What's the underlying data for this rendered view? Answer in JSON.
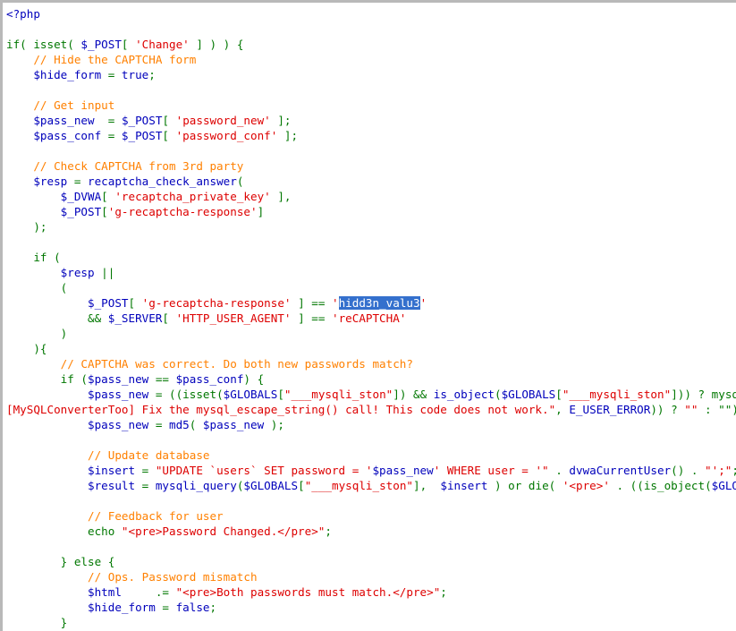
{
  "colors": {
    "keyword": "#007700",
    "variable": "#0000bb",
    "string": "#dd0000",
    "comment": "#ff8000",
    "selection_bg": "#3470cd",
    "selection_fg": "#ffffff"
  },
  "lines": [
    [
      [
        "var",
        "<?php"
      ]
    ],
    [],
    [
      [
        "kw",
        "if( isset( "
      ],
      [
        "var",
        "$_POST"
      ],
      [
        "kw",
        "[ "
      ],
      [
        "str",
        "'Change'"
      ],
      [
        "kw",
        " ] ) ) {"
      ]
    ],
    [
      [
        "kw",
        "    "
      ],
      [
        "cmt",
        "// Hide the CAPTCHA form"
      ]
    ],
    [
      [
        "kw",
        "    "
      ],
      [
        "var",
        "$hide_form"
      ],
      [
        "kw",
        " = "
      ],
      [
        "var",
        "true"
      ],
      [
        "kw",
        ";"
      ]
    ],
    [],
    [
      [
        "kw",
        "    "
      ],
      [
        "cmt",
        "// Get input"
      ]
    ],
    [
      [
        "kw",
        "    "
      ],
      [
        "var",
        "$pass_new"
      ],
      [
        "kw",
        "  = "
      ],
      [
        "var",
        "$_POST"
      ],
      [
        "kw",
        "[ "
      ],
      [
        "str",
        "'password_new'"
      ],
      [
        "kw",
        " ];"
      ]
    ],
    [
      [
        "kw",
        "    "
      ],
      [
        "var",
        "$pass_conf"
      ],
      [
        "kw",
        " = "
      ],
      [
        "var",
        "$_POST"
      ],
      [
        "kw",
        "[ "
      ],
      [
        "str",
        "'password_conf'"
      ],
      [
        "kw",
        " ];"
      ]
    ],
    [],
    [
      [
        "kw",
        "    "
      ],
      [
        "cmt",
        "// Check CAPTCHA from 3rd party"
      ]
    ],
    [
      [
        "kw",
        "    "
      ],
      [
        "var",
        "$resp"
      ],
      [
        "kw",
        " = "
      ],
      [
        "var",
        "recaptcha_check_answer"
      ],
      [
        "kw",
        "("
      ]
    ],
    [
      [
        "kw",
        "        "
      ],
      [
        "var",
        "$_DVWA"
      ],
      [
        "kw",
        "[ "
      ],
      [
        "str",
        "'recaptcha_private_key'"
      ],
      [
        "kw",
        " ],"
      ]
    ],
    [
      [
        "kw",
        "        "
      ],
      [
        "var",
        "$_POST"
      ],
      [
        "kw",
        "["
      ],
      [
        "str",
        "'g-recaptcha-response'"
      ],
      [
        "kw",
        "]"
      ]
    ],
    [
      [
        "kw",
        "    );"
      ]
    ],
    [],
    [
      [
        "kw",
        "    if ("
      ]
    ],
    [
      [
        "kw",
        "        "
      ],
      [
        "var",
        "$resp"
      ],
      [
        "kw",
        " ||"
      ]
    ],
    [
      [
        "kw",
        "        ("
      ]
    ],
    [
      [
        "kw",
        "            "
      ],
      [
        "var",
        "$_POST"
      ],
      [
        "kw",
        "[ "
      ],
      [
        "str",
        "'g-recaptcha-response'"
      ],
      [
        "kw",
        " ] == "
      ],
      [
        "str",
        "'"
      ],
      [
        "hl",
        "hidd3n_valu3"
      ],
      [
        "str",
        "'"
      ]
    ],
    [
      [
        "kw",
        "            && "
      ],
      [
        "var",
        "$_SERVER"
      ],
      [
        "kw",
        "[ "
      ],
      [
        "str",
        "'HTTP_USER_AGENT'"
      ],
      [
        "kw",
        " ] == "
      ],
      [
        "str",
        "'reCAPTCHA'"
      ]
    ],
    [
      [
        "kw",
        "        )"
      ]
    ],
    [
      [
        "kw",
        "    ){"
      ]
    ],
    [
      [
        "kw",
        "        "
      ],
      [
        "cmt",
        "// CAPTCHA was correct. Do both new passwords match?"
      ]
    ],
    [
      [
        "kw",
        "        if ("
      ],
      [
        "var",
        "$pass_new"
      ],
      [
        "kw",
        " == "
      ],
      [
        "var",
        "$pass_conf"
      ],
      [
        "kw",
        ") {"
      ]
    ],
    [
      [
        "kw",
        "            "
      ],
      [
        "var",
        "$pass_new"
      ],
      [
        "kw",
        " = ((isset("
      ],
      [
        "var",
        "$GLOBALS"
      ],
      [
        "kw",
        "["
      ],
      [
        "str",
        "\"___mysqli_ston\""
      ],
      [
        "kw",
        "]) && "
      ],
      [
        "var",
        "is_object"
      ],
      [
        "kw",
        "("
      ],
      [
        "var",
        "$GLOBALS"
      ],
      [
        "kw",
        "["
      ],
      [
        "str",
        "\"___mysqli_ston\""
      ],
      [
        "kw",
        "])) ? mysqli_real_escape_string("
      ]
    ],
    [
      [
        "str",
        "[MySQLConverterToo] Fix the mysql_escape_string() call! This code does not work.\""
      ],
      [
        "kw",
        ", "
      ],
      [
        "var",
        "E_USER_ERROR"
      ],
      [
        "kw",
        ")) ? "
      ],
      [
        "str",
        "\"\""
      ],
      [
        "kw",
        " : \"\"));"
      ]
    ],
    [
      [
        "kw",
        "            "
      ],
      [
        "var",
        "$pass_new"
      ],
      [
        "kw",
        " = "
      ],
      [
        "var",
        "md5"
      ],
      [
        "kw",
        "( "
      ],
      [
        "var",
        "$pass_new"
      ],
      [
        "kw",
        " );"
      ]
    ],
    [],
    [
      [
        "kw",
        "            "
      ],
      [
        "cmt",
        "// Update database"
      ]
    ],
    [
      [
        "kw",
        "            "
      ],
      [
        "var",
        "$insert"
      ],
      [
        "kw",
        " = "
      ],
      [
        "str",
        "\"UPDATE `users` SET password = '"
      ],
      [
        "var",
        "$pass_new"
      ],
      [
        "str",
        "' WHERE user = '\""
      ],
      [
        "kw",
        " . "
      ],
      [
        "var",
        "dvwaCurrentUser"
      ],
      [
        "kw",
        "() . "
      ],
      [
        "str",
        "\"';\""
      ],
      [
        "kw",
        ";"
      ]
    ],
    [
      [
        "kw",
        "            "
      ],
      [
        "var",
        "$result"
      ],
      [
        "kw",
        " = "
      ],
      [
        "var",
        "mysqli_query"
      ],
      [
        "kw",
        "("
      ],
      [
        "var",
        "$GLOBALS"
      ],
      [
        "kw",
        "["
      ],
      [
        "str",
        "\"___mysqli_ston\""
      ],
      [
        "kw",
        "],  "
      ],
      [
        "var",
        "$insert"
      ],
      [
        "kw",
        " ) or die( "
      ],
      [
        "str",
        "'<pre>'"
      ],
      [
        "kw",
        " . ((is_object("
      ],
      [
        "var",
        "$GLOBALS"
      ],
      [
        "kw",
        "["
      ]
    ],
    [],
    [
      [
        "kw",
        "            "
      ],
      [
        "cmt",
        "// Feedback for user"
      ]
    ],
    [
      [
        "kw",
        "            echo "
      ],
      [
        "str",
        "\"<pre>Password Changed.</pre>\""
      ],
      [
        "kw",
        ";"
      ]
    ],
    [],
    [
      [
        "kw",
        "        } else {"
      ]
    ],
    [
      [
        "kw",
        "            "
      ],
      [
        "cmt",
        "// Ops. Password mismatch"
      ]
    ],
    [
      [
        "kw",
        "            "
      ],
      [
        "var",
        "$html"
      ],
      [
        "kw",
        "     .= "
      ],
      [
        "str",
        "\"<pre>Both passwords must match.</pre>\""
      ],
      [
        "kw",
        ";"
      ]
    ],
    [
      [
        "kw",
        "            "
      ],
      [
        "var",
        "$hide_form"
      ],
      [
        "kw",
        " = "
      ],
      [
        "var",
        "false"
      ],
      [
        "kw",
        ";"
      ]
    ],
    [
      [
        "kw",
        "        }"
      ]
    ]
  ]
}
